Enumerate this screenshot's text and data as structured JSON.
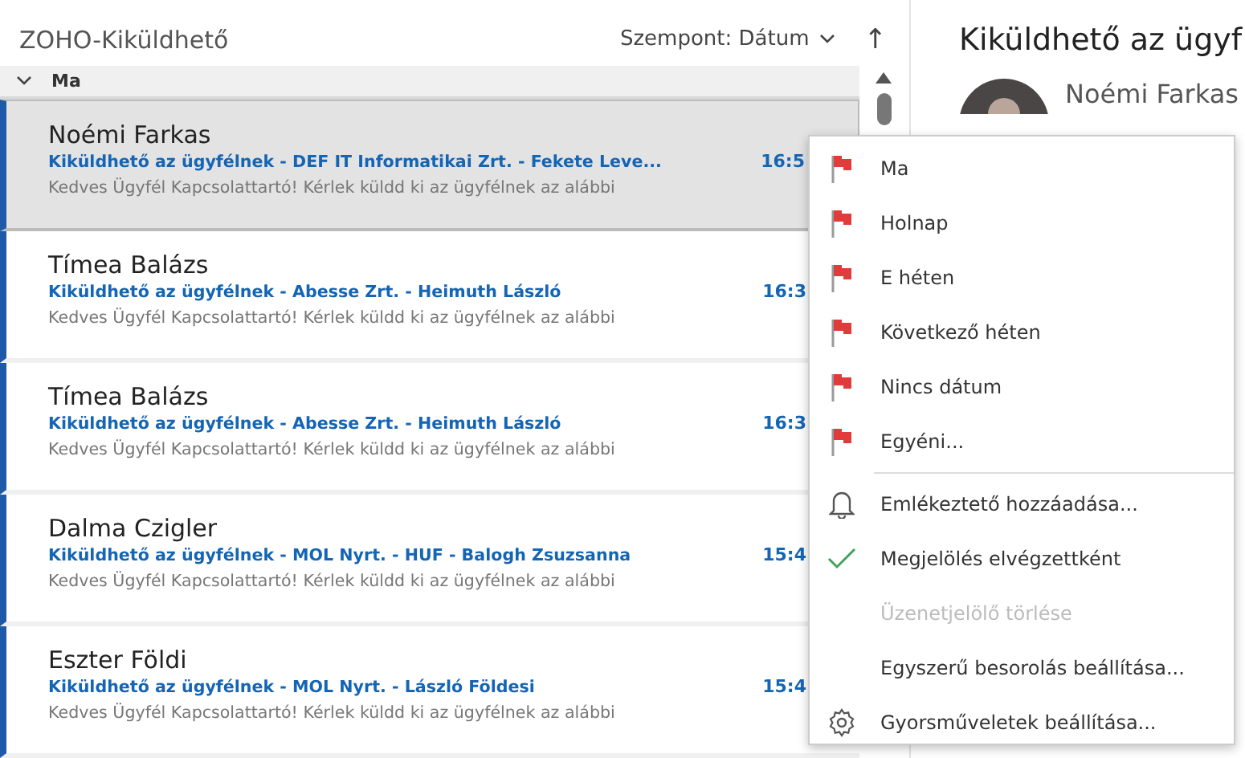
{
  "folder": {
    "title": "ZOHO-Kiküldhető",
    "sort_label": "Szempont: Dátum",
    "sort_arrow": "↑"
  },
  "group": {
    "label": "Ma",
    "expanded": true
  },
  "messages": [
    {
      "sender": "Noémi Farkas",
      "subject": "Kiküldhető az ügyfélnek - DEF IT Informatikai Zrt. - Fekete Leve...",
      "preview": "Kedves Ügyfél Kapcsolattartó!  Kérlek küldd ki az ügyfélnek az alábbi",
      "time": "16:5",
      "selected": true
    },
    {
      "sender": "Tímea Balázs",
      "subject": "Kiküldhető az ügyfélnek - Abesse Zrt. - Heimuth László",
      "preview": "Kedves Ügyfél Kapcsolattartó!  Kérlek küldd ki az ügyfélnek az alábbi",
      "time": "16:3",
      "selected": false
    },
    {
      "sender": "Tímea Balázs",
      "subject": "Kiküldhető az ügyfélnek - Abesse Zrt. - Heimuth László",
      "preview": "Kedves Ügyfél Kapcsolattartó!  Kérlek küldd ki az ügyfélnek az alábbi",
      "time": "16:3",
      "selected": false
    },
    {
      "sender": "Dalma Czigler",
      "subject": "Kiküldhető az ügyfélnek - MOL Nyrt. - HUF - Balogh Zsuzsanna",
      "preview": "Kedves Ügyfél Kapcsolattartó!  Kérlek küldd ki az ügyfélnek az alábbi",
      "time": "15:4",
      "selected": false
    },
    {
      "sender": "Eszter Földi",
      "subject": "Kiküldhető az ügyfélnek - MOL Nyrt. - László Földesi",
      "preview": "Kedves Ügyfél Kapcsolattartó!  Kérlek küldd ki az ügyfélnek az alábbi",
      "time": "15:4",
      "selected": false
    }
  ],
  "reading_pane": {
    "title": "Kiküldhető az ügyf",
    "sender": "Noémi Farkas"
  },
  "context_menu": [
    {
      "kind": "flag",
      "label": "Ma",
      "disabled": false
    },
    {
      "kind": "flag",
      "label": "Holnap",
      "disabled": false
    },
    {
      "kind": "flag",
      "label": "E héten",
      "disabled": false
    },
    {
      "kind": "flag",
      "label": "Következő héten",
      "disabled": false
    },
    {
      "kind": "flag",
      "label": "Nincs dátum",
      "disabled": false
    },
    {
      "kind": "flag",
      "label": "Egyéni...",
      "disabled": false
    },
    {
      "kind": "separator"
    },
    {
      "kind": "bell",
      "label": "Emlékeztető hozzáadása...",
      "disabled": false
    },
    {
      "kind": "check",
      "label": "Megjelölés elvégzettként",
      "disabled": false
    },
    {
      "kind": "plain",
      "label": "Üzenetjelölő törlése",
      "disabled": true
    },
    {
      "kind": "plain",
      "label": "Egyszerű besorolás beállítása...",
      "disabled": false
    },
    {
      "kind": "gear",
      "label": "Gyorsműveletek beállítása...",
      "disabled": false
    }
  ]
}
